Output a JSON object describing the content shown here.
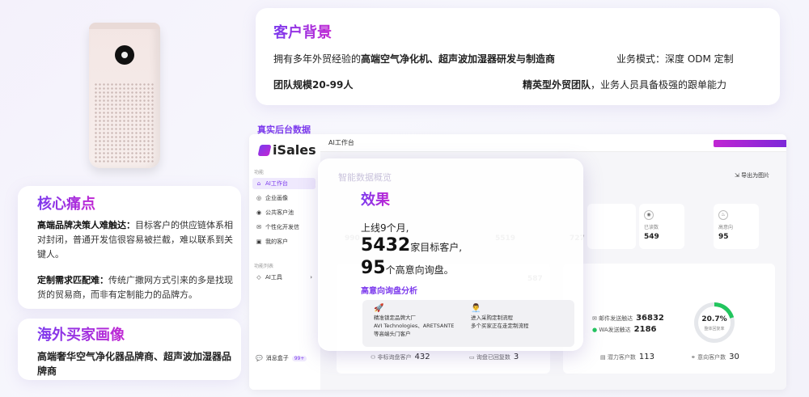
{
  "customer_background": {
    "title": "客户背景",
    "line1_prefix": "拥有多年外贸经验的",
    "line1_bold": "高端空气净化机、超声波加湿器研发与制造商",
    "business_model": "业务模式：深度 ODM 定制",
    "team_size": "团队规模20-99人",
    "team_desc_bold": "精英型外贸团队",
    "team_desc_rest": "，业务人员具备极强的跟单能力"
  },
  "pain_points": {
    "title": "核心痛点",
    "p1_bold": "高端品牌决策人难触达：",
    "p1_text": "目标客户的供应链体系相对封闭，普通开发信很容易被拦截，难以联系到关键人。",
    "p2_bold": "定制需求匹配难：",
    "p2_text": "传统广撒网方式引来的多是找现货的贸易商，而非有定制能力的品牌方。"
  },
  "buyer_profile": {
    "title": "海外买家画像",
    "text": "高端奢华空气净化器品牌商、超声波加湿器品牌商"
  },
  "dashboard": {
    "real_data_label": "真实后台数据",
    "brand": "iSales",
    "section1": "功能",
    "section2": "功能列表",
    "menu": [
      {
        "icon": "⌂",
        "label": "AI工作台",
        "active": true
      },
      {
        "icon": "◎",
        "label": "企业画像",
        "active": false
      },
      {
        "icon": "◉",
        "label": "公共客户池",
        "active": false
      },
      {
        "icon": "✉",
        "label": "个性化开发信",
        "active": false
      },
      {
        "icon": "▣",
        "label": "我的客户",
        "active": false
      }
    ],
    "menu2": {
      "icon": "◇",
      "label": "AI工具"
    },
    "footer_label": "消息盒子",
    "footer_badge": "99+",
    "topbar_title": "AI工作台",
    "export_label": "导出为图片",
    "stats": [
      {
        "label": "已读数",
        "value": "549",
        "icon": "eye-icon"
      },
      {
        "label": "高意向",
        "value": "95",
        "icon": "fire-icon"
      }
    ],
    "ghost_values": [
      "990",
      "5519",
      "727",
      "587"
    ],
    "contacts": [
      {
        "label": "邮件发送触达",
        "value": "36832"
      },
      {
        "label": "WA发送触达",
        "value": "2186"
      }
    ],
    "ring": {
      "value": "20.7%",
      "label": "整体回复率",
      "fraction": 0.207
    },
    "bottom_stats": [
      {
        "label": "非标询盘客户",
        "value": "432"
      },
      {
        "label": "询盘已回复数",
        "value": "3"
      },
      {
        "label": "潜力客户数",
        "value": "113"
      },
      {
        "label": "意向客户数",
        "value": "30"
      }
    ]
  },
  "effect": {
    "ghost_title": "智能数据概览",
    "title": "效果",
    "line1": "上线9个月,",
    "big1": "5432",
    "line2_suffix": "家目标客户,",
    "big2": "95",
    "line3_suffix": "个高意向询盘。",
    "sub_title": "高意向询盘分析",
    "col1_emoji": "🚀",
    "col1_text": "精准锁定品牌大厂\nAVI Technologies、ARETSANTE\n等高端头门客户",
    "col2_emoji": "👨‍💼",
    "col2_text": "进入采购定制流程\n多个买家正在走定制流程"
  }
}
